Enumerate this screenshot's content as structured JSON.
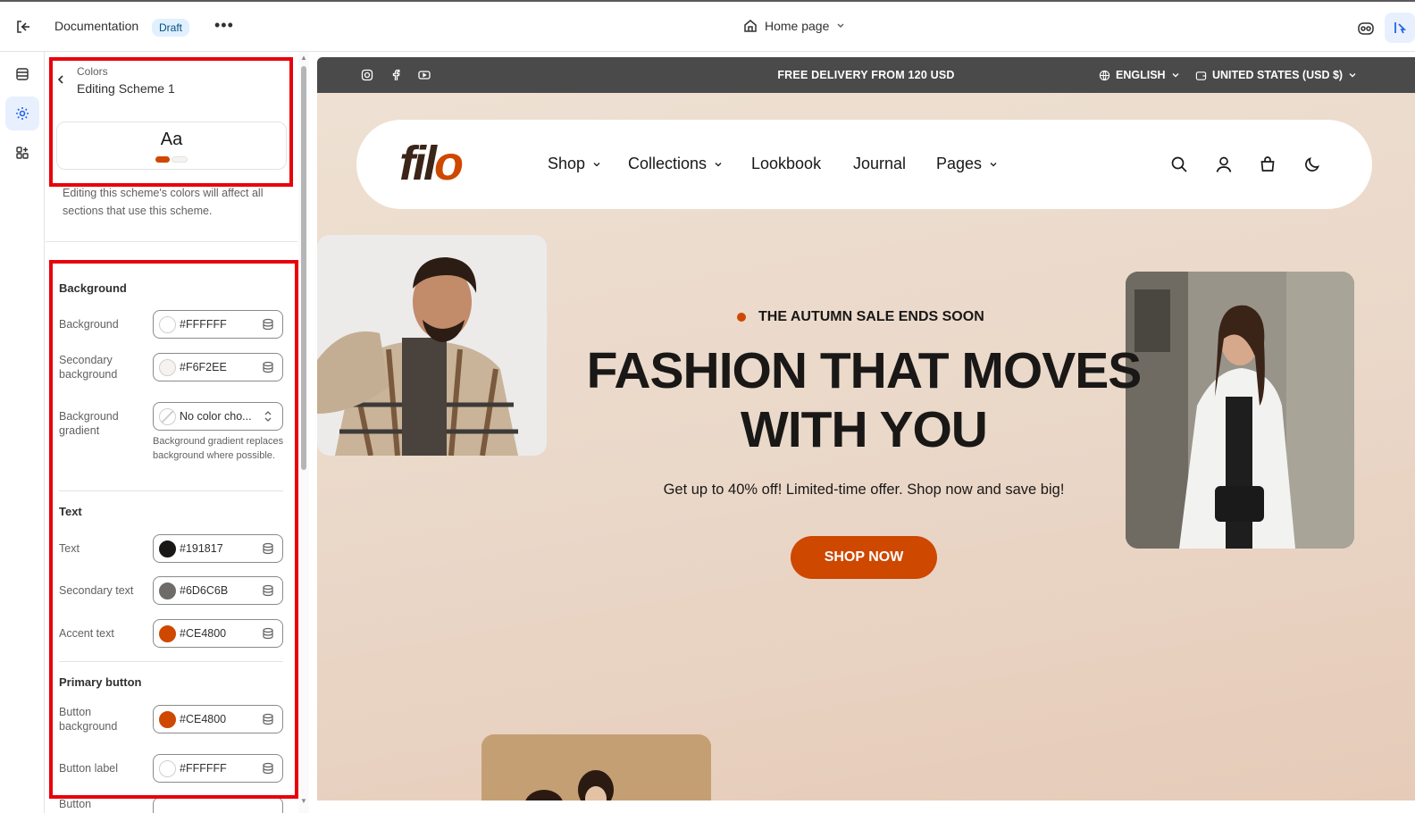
{
  "topbar": {
    "title": "Documentation",
    "badge": "Draft",
    "more": "•••",
    "page_selector": "Home page"
  },
  "panel": {
    "breadcrumb": "Colors",
    "title": "Editing Scheme 1",
    "preview_text": "Aa",
    "description": "Editing this scheme's colors will affect all sections that use this scheme.",
    "sections": {
      "background": {
        "title": "Background",
        "rows": [
          {
            "label": "Background",
            "value": "#FFFFFF",
            "swatch": "#FFFFFF"
          },
          {
            "label": "Secondary background",
            "value": "#F6F2EE",
            "swatch": "#F6F2EE"
          },
          {
            "label": "Background gradient",
            "value": "No color cho...",
            "hint": "Background gradient replaces background where possible."
          }
        ]
      },
      "text": {
        "title": "Text",
        "rows": [
          {
            "label": "Text",
            "value": "#191817",
            "swatch": "#191817"
          },
          {
            "label": "Secondary text",
            "value": "#6D6C6B",
            "swatch": "#6D6C6B"
          },
          {
            "label": "Accent text",
            "value": "#CE4800",
            "swatch": "#CE4800"
          }
        ]
      },
      "primary_button": {
        "title": "Primary button",
        "rows": [
          {
            "label": "Button background",
            "value": "#CE4800",
            "swatch": "#CE4800"
          },
          {
            "label": "Button label",
            "value": "#FFFFFF",
            "swatch": "#FFFFFF"
          }
        ],
        "cutoff_label": "Button"
      }
    }
  },
  "store": {
    "announcement": "FREE DELIVERY FROM 120 USD",
    "language": "ENGLISH",
    "currency": "UNITED STATES (USD $)",
    "logo_a": "fil",
    "logo_b": "o",
    "nav": [
      "Shop",
      "Collections",
      "Lookbook",
      "Journal",
      "Pages"
    ],
    "eyebrow": "THE AUTUMN SALE ENDS SOON",
    "headline": "FASHION THAT MOVES WITH YOU",
    "subline": "Get up to 40% off! Limited-time offer. Shop now and save big!",
    "cta": "SHOP NOW"
  },
  "colors": {
    "accent": "#CE4800",
    "text": "#191817",
    "highlight": "#e8000b"
  }
}
